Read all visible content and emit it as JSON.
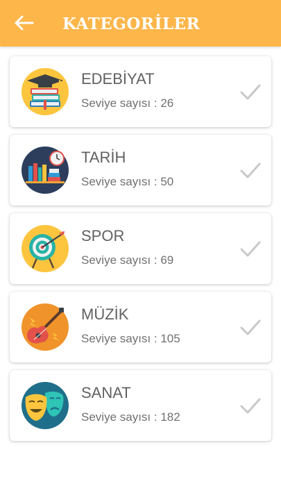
{
  "header": {
    "title": "KATEGORİLER",
    "back_icon": "arrow-left-icon"
  },
  "colors": {
    "accent": "#fdb64a",
    "text_primary": "#616161",
    "text_secondary": "#707070",
    "check": "#c8c8c8"
  },
  "categories": [
    {
      "name": "EDEBİYAT",
      "levels": "Seviye sayısı : 26",
      "icon": "books-graduation-cap-icon"
    },
    {
      "name": "TARİH",
      "levels": "Seviye sayısı : 50",
      "icon": "bookshelf-clock-icon"
    },
    {
      "name": "SPOR",
      "levels": "Seviye sayısı : 69",
      "icon": "target-arrow-icon"
    },
    {
      "name": "MÜZİK",
      "levels": "Seviye sayısı : 105",
      "icon": "electric-guitar-icon"
    },
    {
      "name": "SANAT",
      "levels": "Seviye sayısı : 182",
      "icon": "theater-masks-icon"
    }
  ]
}
